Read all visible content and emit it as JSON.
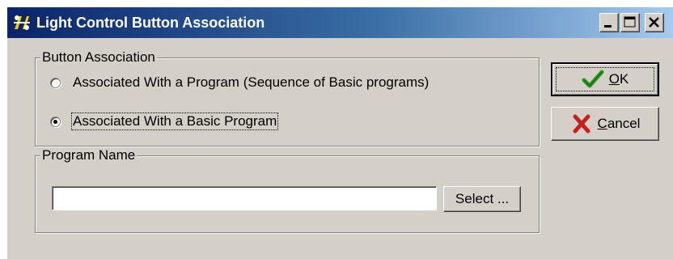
{
  "window": {
    "title": "Light Control Button Association"
  },
  "icons": {
    "app": "app-logo-icon",
    "minimize": "minimize-icon",
    "maximize": "maximize-icon",
    "close": "close-icon",
    "ok": "checkmark-icon",
    "cancel": "x-icon"
  },
  "button_association": {
    "legend": "Button Association",
    "options": [
      {
        "label": "Associated With a Program (Sequence of Basic programs)",
        "selected": false
      },
      {
        "label": "Associated With a Basic Program",
        "selected": true
      }
    ]
  },
  "program_name": {
    "legend": "Program Name",
    "value": "",
    "select_label": "Select ..."
  },
  "buttons": {
    "ok_mnemonic": "O",
    "ok_rest": "K",
    "cancel_mnemonic": "C",
    "cancel_rest": "ancel"
  },
  "colors": {
    "title_gradient_start": "#0a246a",
    "title_gradient_end": "#a6caf0",
    "face": "#d4d0c8",
    "ok_check": "#2e9a1e",
    "cancel_x": "#c81e1e"
  }
}
